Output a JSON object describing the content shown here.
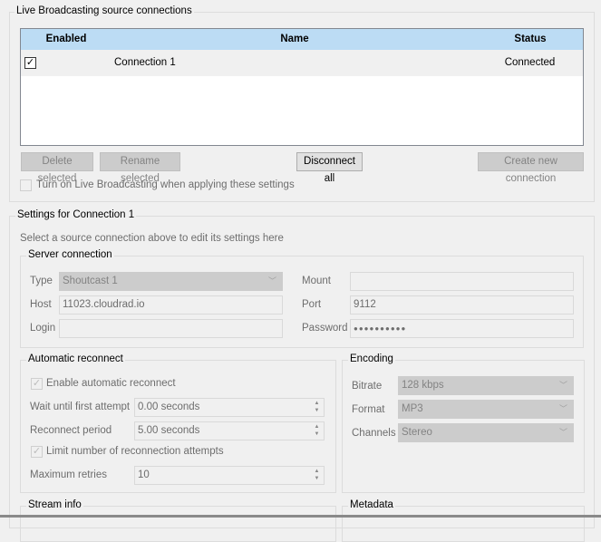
{
  "connections_group": {
    "title": "Live Broadcasting source connections",
    "columns": {
      "enabled": "Enabled",
      "name": "Name",
      "status": "Status"
    },
    "rows": [
      {
        "enabled": true,
        "name": "Connection 1",
        "status": "Connected"
      }
    ],
    "buttons": {
      "delete": "Delete selected",
      "rename": "Rename selected",
      "disconnect": "Disconnect all",
      "create": "Create new connection"
    },
    "turn_on_label": "Turn on Live Broadcasting when applying these settings"
  },
  "settings": {
    "title": "Settings for Connection 1",
    "hint": "Select a source connection above to edit its settings here",
    "server": {
      "title": "Server connection",
      "type_label": "Type",
      "type_value": "Shoutcast 1",
      "mount_label": "Mount",
      "mount_value": "",
      "host_label": "Host",
      "host_value": "11023.cloudrad.io",
      "port_label": "Port",
      "port_value": "9112",
      "login_label": "Login",
      "login_value": "",
      "password_label": "Password",
      "password_value": "●●●●●●●●●●"
    },
    "reconnect": {
      "title": "Automatic reconnect",
      "enable_label": "Enable automatic reconnect",
      "wait_label": "Wait until first attempt",
      "wait_value": "0.00 seconds",
      "period_label": "Reconnect period",
      "period_value": "5.00 seconds",
      "limit_label": "Limit number of reconnection attempts",
      "retries_label": "Maximum retries",
      "retries_value": "10"
    },
    "encoding": {
      "title": "Encoding",
      "bitrate_label": "Bitrate",
      "bitrate_value": "128 kbps",
      "format_label": "Format",
      "format_value": "MP3",
      "channels_label": "Channels",
      "channels_value": "Stereo"
    },
    "stream_info_title": "Stream info",
    "metadata_title": "Metadata"
  }
}
